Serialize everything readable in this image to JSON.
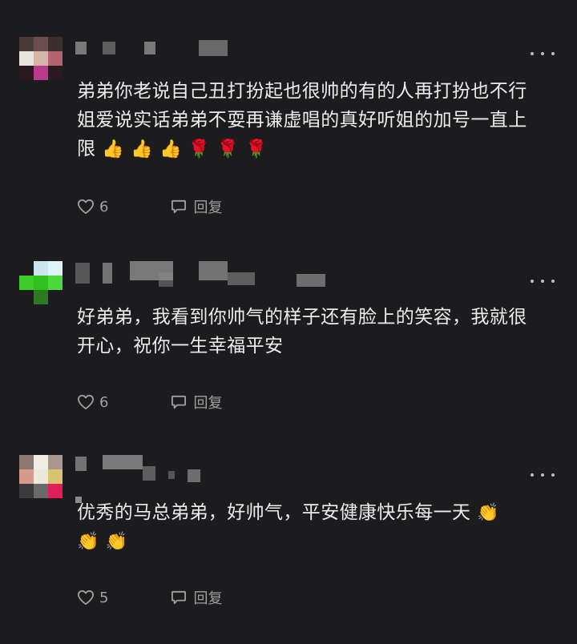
{
  "comments": [
    {
      "text": "弟弟你老说自己丑打扮起也很帅的有的人再打扮也不行姐爱说实话弟弟不耍再谦虚唱的真好听姐的加号一直上限",
      "emojis": [
        "👍",
        "👍",
        "👍",
        "🌹",
        "🌹",
        "🌹"
      ],
      "likes": "6",
      "reply_label": "回复",
      "avatar_colors": [
        "#4a3b3b",
        "#6b4d4f",
        "#3d2e2e",
        "#e8e4e0",
        "#d7b4a8",
        "#b3646e",
        "#2a1a1f",
        "#b83c8c",
        "#2a1a1f"
      ]
    },
    {
      "text": "好弟弟，我看到你帅气的样子还有脸上的笑容，我就很开心，祝你一生幸福平安",
      "emojis": [],
      "likes": "6",
      "reply_label": "回复",
      "avatar_colors": [
        "#1c1c1e",
        "#c8e6ee",
        "#e0f4f8",
        "#3bcc2a",
        "#2fc21e",
        "#4ad83a",
        "#1c1c1e",
        "#2e7a24",
        "#1c1c1e"
      ]
    },
    {
      "text": "优秀的马总弟弟，好帅气，平安健康快乐每一天",
      "emojis": [
        "👏",
        "👏",
        "👏"
      ],
      "likes": "5",
      "reply_label": "回复",
      "avatar_colors": [
        "#8a7a72",
        "#f0ece6",
        "#a89890",
        "#d89a8c",
        "#ece8da",
        "#d8c470",
        "#3a3a3c",
        "#6a6a6a",
        "#e01e5a"
      ]
    }
  ]
}
